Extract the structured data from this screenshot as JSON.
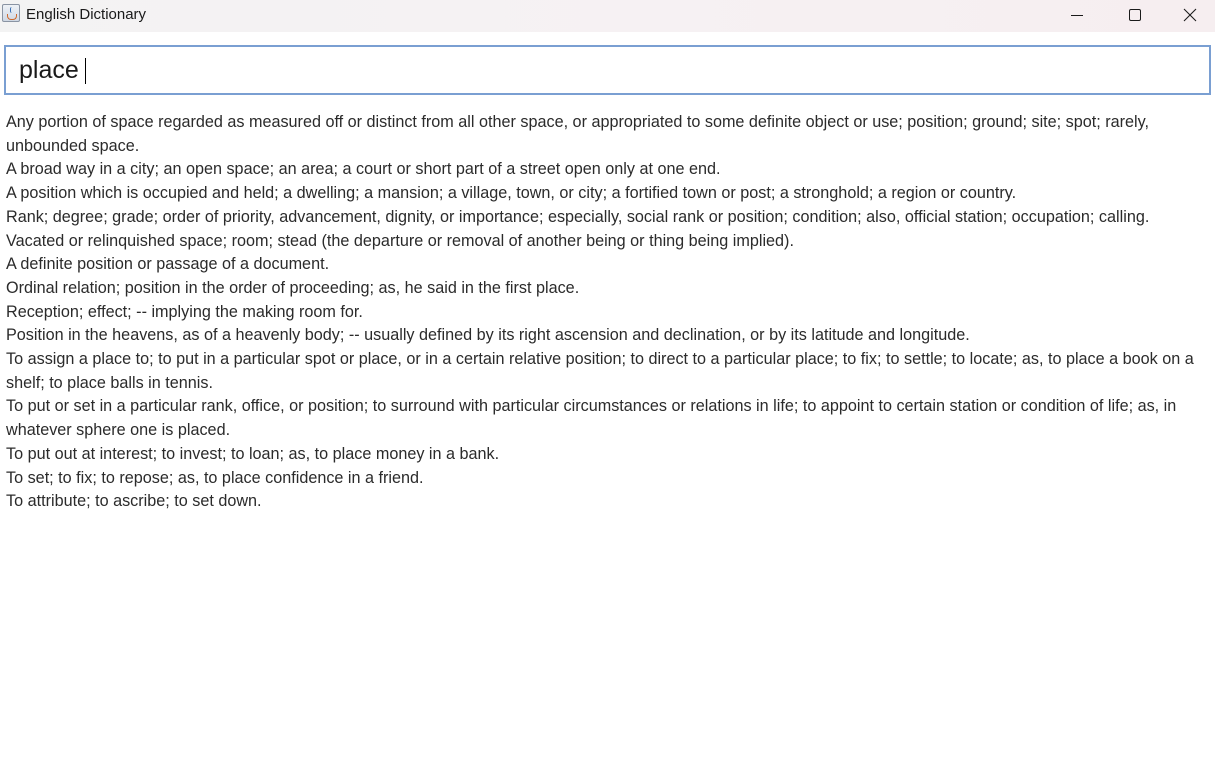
{
  "window": {
    "title": "English Dictionary",
    "icon": "java-cup-icon"
  },
  "search": {
    "value": "place"
  },
  "definitions": [
    "Any portion of space regarded as measured off or distinct from all other space, or appropriated to some definite object or use; position; ground; site; spot; rarely, unbounded space.",
    "A broad way in a city; an open space; an area; a court or short part of a street open only at one end.",
    "A position which is occupied and held; a dwelling; a mansion; a village, town, or city; a fortified town or post; a stronghold; a region or country.",
    "Rank; degree; grade; order of priority, advancement, dignity, or importance; especially, social rank or position; condition; also, official station; occupation; calling.",
    "Vacated or relinquished space; room; stead (the departure or removal of another being or thing being implied).",
    "A definite position or passage of a document.",
    "Ordinal relation; position in the order of proceeding; as, he said in the first place.",
    "Reception; effect; -- implying the making room for.",
    "Position in the heavens, as of a heavenly body; -- usually defined by its right ascension and declination, or by its latitude and longitude.",
    "To assign a place to; to put in a particular spot or place, or in a certain relative position; to direct to a particular place; to fix; to settle; to locate; as, to place a book on a shelf; to place balls in tennis.",
    "To put or set in a particular rank, office, or position; to surround with particular circumstances or relations in life; to appoint to certain station or condition of life; as, in whatever sphere one is placed.",
    "To put out at interest; to invest; to loan; as, to place money in a bank.",
    "To set; to fix; to repose; as, to place confidence in a friend.",
    "To attribute; to ascribe; to set down."
  ],
  "colors": {
    "input_border": "#7a9fd2",
    "text": "#2b2b2b",
    "background": "#ffffff"
  }
}
